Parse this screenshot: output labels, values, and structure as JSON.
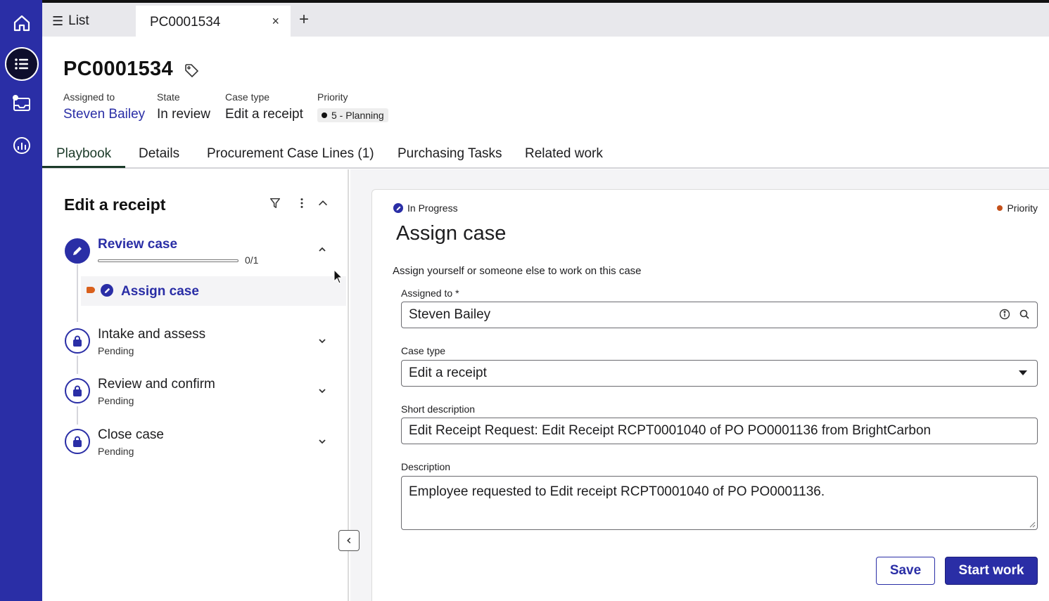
{
  "topbar": {
    "list_label": "List",
    "case_tab_label": "PC0001534",
    "close_glyph": "×",
    "add_glyph": "+"
  },
  "header": {
    "case_number": "PC0001534",
    "assigned_to_label": "Assigned to",
    "assigned_to_value": "Steven Bailey",
    "state_label": "State",
    "state_value": "In review",
    "case_type_label": "Case type",
    "case_type_value": "Edit a receipt",
    "priority_label": "Priority",
    "priority_value": "5 - Planning"
  },
  "tabs": [
    {
      "label": "Playbook",
      "active": true
    },
    {
      "label": "Details",
      "active": false
    },
    {
      "label": "Procurement Case Lines (1)",
      "active": false
    },
    {
      "label": "Purchasing Tasks",
      "active": false
    },
    {
      "label": "Related work",
      "active": false
    }
  ],
  "playbook": {
    "title": "Edit a receipt",
    "stages": [
      {
        "name": "Review case",
        "status": "",
        "progress_text": "0/1",
        "progress_fraction": 0,
        "active": true
      },
      {
        "name": "Intake and assess",
        "status": "Pending",
        "active": false
      },
      {
        "name": "Review and confirm",
        "status": "Pending",
        "active": false
      },
      {
        "name": "Close case",
        "status": "Pending",
        "active": false
      }
    ],
    "active_step": "Assign case"
  },
  "card": {
    "status": "In Progress",
    "priority_label": "Priority",
    "title": "Assign case",
    "description": "Assign yourself or someone else to work on this case",
    "fields": {
      "assigned_to_label": "Assigned to",
      "required_mark": "*",
      "assigned_to_value": "Steven Bailey",
      "case_type_label": "Case type",
      "case_type_value": "Edit a receipt",
      "short_description_label": "Short description",
      "short_description_value": "Edit Receipt Request: Edit Receipt RCPT0001040 of PO PO0001136 from BrightCarbon",
      "description_label": "Description",
      "description_value": "Employee requested to Edit receipt RCPT0001040 of PO PO0001136."
    },
    "save_label": "Save",
    "start_label": "Start work"
  },
  "colors": {
    "accent": "#2a2ea6",
    "rail": "#2a2ea6",
    "priority_orange": "#d9601c",
    "tab_active": "#1b3a28"
  },
  "icons": [
    "home-icon",
    "list-icon",
    "inbox-icon",
    "dashboard-icon",
    "tag-icon",
    "filter-icon",
    "more-icon",
    "chevron-up-icon",
    "chevron-down-icon",
    "pencil-icon",
    "lock-icon",
    "info-icon",
    "search-icon",
    "chevron-left-icon"
  ]
}
